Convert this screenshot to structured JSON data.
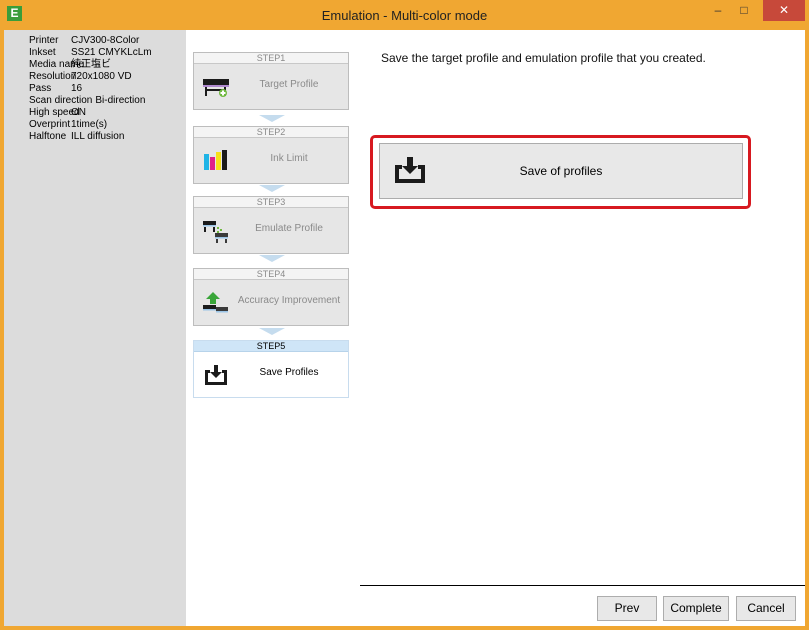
{
  "window": {
    "title": "Emulation - Multi-color mode",
    "app_icon_glyph": "E",
    "minimize_glyph": "–",
    "maximize_glyph": "□",
    "close_glyph": "✕"
  },
  "info": {
    "printer_label": "Printer",
    "printer_value": "CJV300-8Color",
    "inkset_label": "Inkset",
    "inkset_value": "SS21 CMYKLcLm",
    "media_label": "Media name",
    "media_value": "純正塩ビ",
    "resolution_label": "Resolution",
    "resolution_value": "720x1080 VD",
    "pass_label": "Pass",
    "pass_value": "16",
    "scan_label": "Scan direction",
    "scan_value": "Bi-direction",
    "speed_label": "High speed",
    "speed_value": "ON",
    "overprint_label": "Overprint",
    "overprint_value": "1time(s)",
    "halftone_label": "Halftone",
    "halftone_value": "ILL diffusion"
  },
  "steps": [
    {
      "head": "STEP1",
      "label": "Target Profile",
      "icon": "printer-icon",
      "active": false
    },
    {
      "head": "STEP2",
      "label": "Ink Limit",
      "icon": "ink-bars-icon",
      "active": false
    },
    {
      "head": "STEP3",
      "label": "Emulate Profile",
      "icon": "emulate-icon",
      "active": false
    },
    {
      "head": "STEP4",
      "label": "Accuracy Improvement",
      "icon": "accuracy-icon",
      "active": false
    },
    {
      "head": "STEP5",
      "label": "Save Profiles",
      "icon": "save-tray-icon",
      "active": true
    }
  ],
  "main": {
    "instruction": "Save the target profile and emulation profile that you created.",
    "save_button_label": "Save of profiles"
  },
  "footer": {
    "prev_label": "Prev",
    "complete_label": "Complete",
    "cancel_label": "Cancel"
  },
  "colors": {
    "title_bar": "#f0a732",
    "close_button": "#c7493a",
    "highlight_border": "#d71920",
    "active_step_head": "#cfe5f7",
    "side_panel": "#dcdcdc"
  }
}
